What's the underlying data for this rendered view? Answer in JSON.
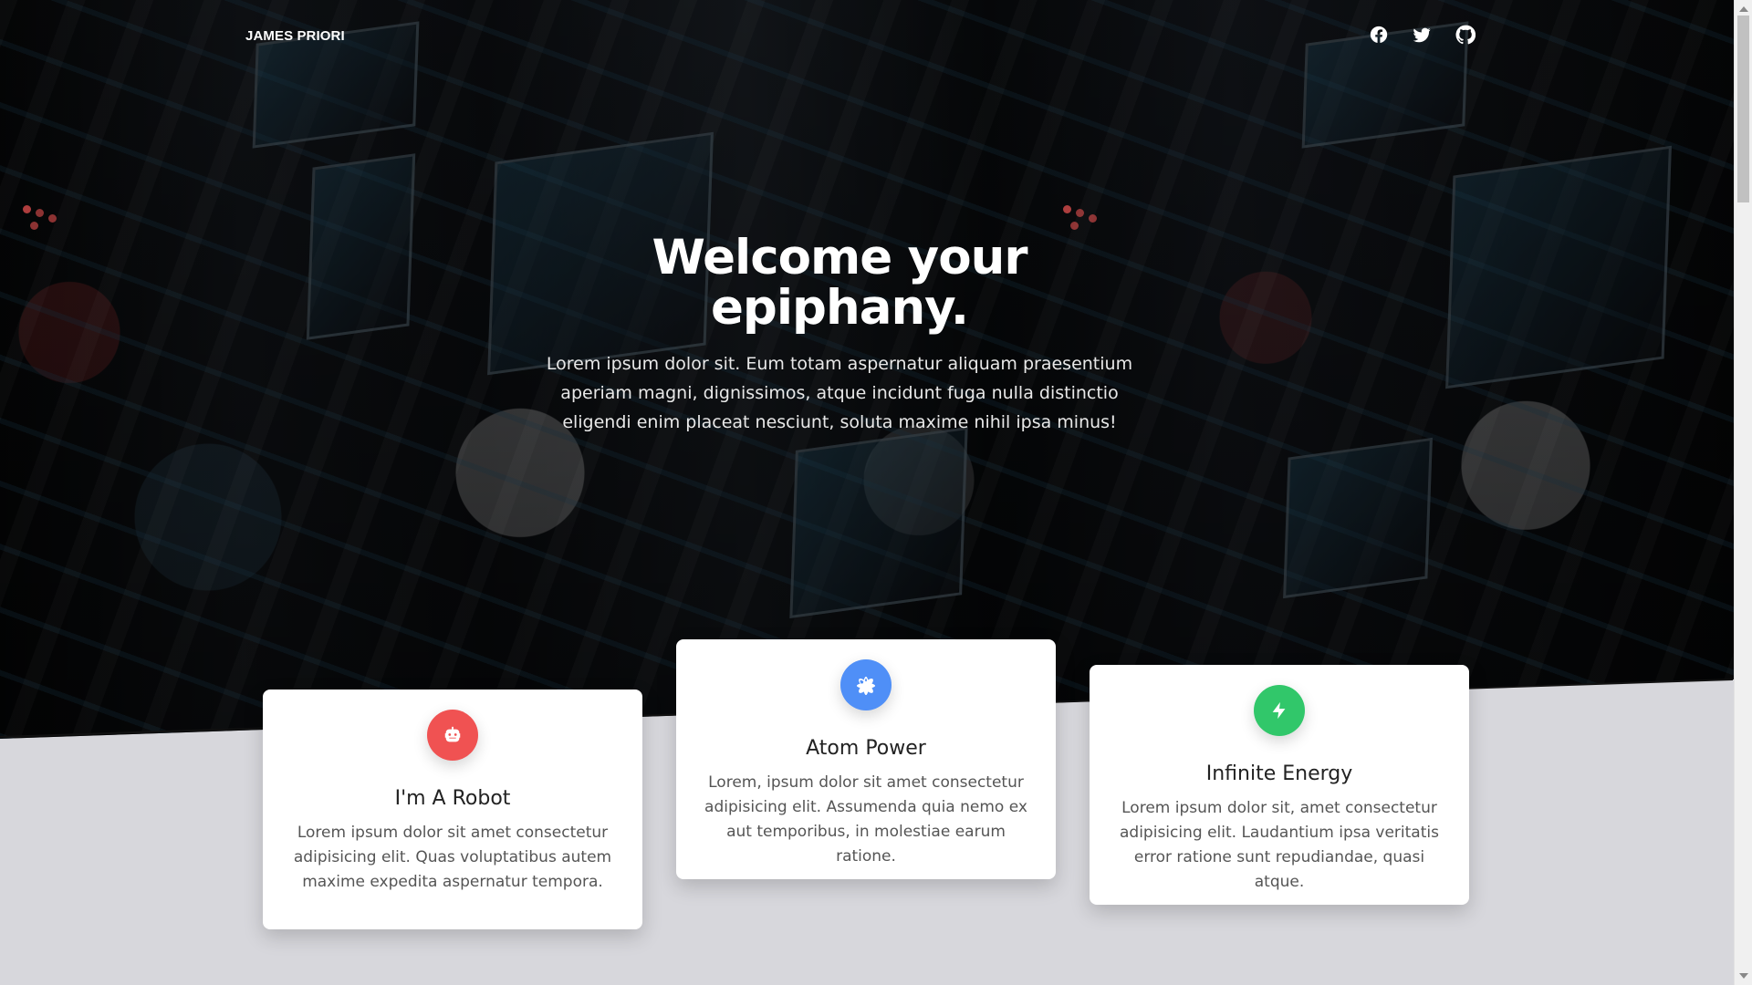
{
  "nav": {
    "brand": "JAMES PRIORI",
    "social": [
      {
        "name": "facebook",
        "icon": "facebook-icon"
      },
      {
        "name": "twitter",
        "icon": "twitter-icon"
      },
      {
        "name": "github",
        "icon": "github-icon"
      }
    ]
  },
  "hero": {
    "title": "Welcome your epiphany.",
    "text": "Lorem ipsum dolor sit. Eum totam aspernatur aliquam praesentium aperiam magni, dignissimos, atque incidunt fuga nulla distinctio eligendi enim placeat nesciunt, soluta maxime nihil ipsa minus!"
  },
  "features": [
    {
      "title": "I'm A Robot",
      "text": "Lorem ipsum dolor sit amet consectetur adipisicing elit. Quas voluptatibus autem maxime expedita aspernatur tempora.",
      "icon": "robot-icon",
      "color": "#f05252"
    },
    {
      "title": "Atom Power",
      "text": "Lorem, ipsum dolor sit amet consectetur adipisicing elit. Assumenda quia nemo ex aut temporibus, in molestiae earum ratione.",
      "icon": "atom-icon",
      "color": "#4f8ff7"
    },
    {
      "title": "Infinite Energy",
      "text": "Lorem ipsum dolor sit, amet consectetur adipisicing elit. Laudantium ipsa veritatis error ratione sunt repudiandae, quasi atque.",
      "icon": "lightning-icon",
      "color": "#31c76a"
    }
  ],
  "colors": {
    "hero_overlay": "#050607",
    "page_background": "#d7d7dc",
    "card_background": "#ffffff"
  }
}
